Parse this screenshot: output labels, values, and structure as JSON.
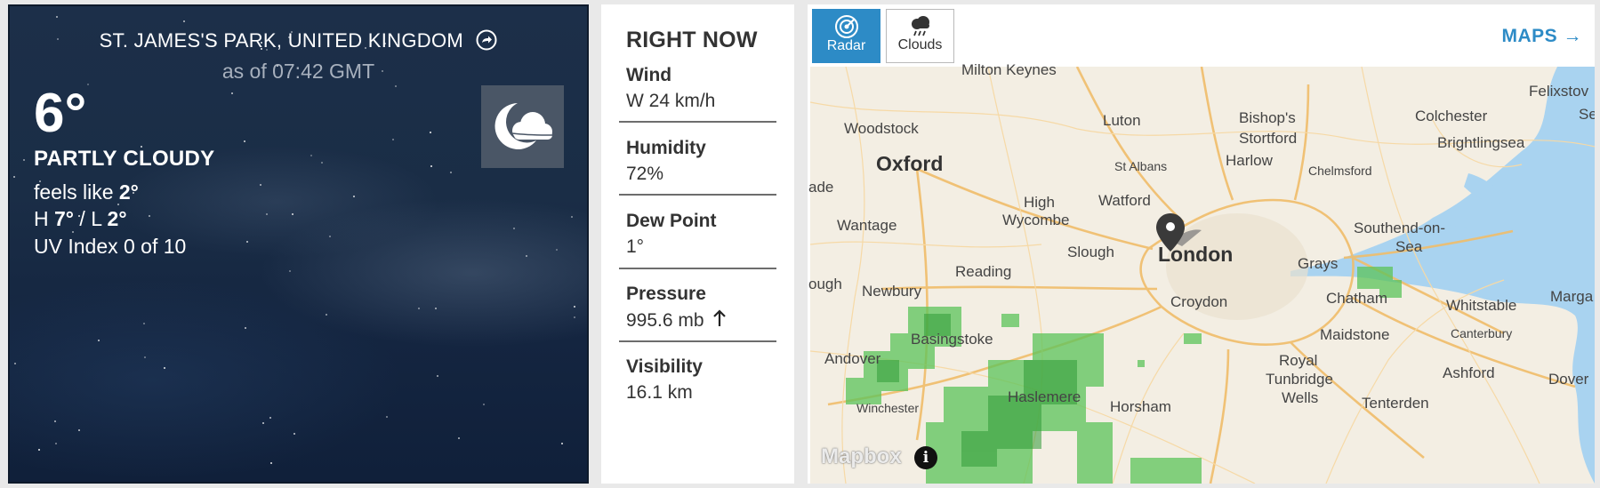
{
  "current": {
    "location": "ST. JAMES'S PARK, UNITED KINGDOM",
    "as_of": "as of 07:42 GMT",
    "temperature": "6°",
    "condition": "PARTLY CLOUDY",
    "feels_like_label": "feels like",
    "feels_like_value": "2°",
    "high_label": "H",
    "high_value": "7°",
    "low_label": "L",
    "low_value": "2°",
    "uv_index": "UV Index 0 of 10",
    "icon": "moon-cloud-icon"
  },
  "right_now": {
    "title": "RIGHT NOW",
    "items": [
      {
        "label": "Wind",
        "value": "W 24 km/h"
      },
      {
        "label": "Humidity",
        "value": "72%"
      },
      {
        "label": "Dew Point",
        "value": "1°"
      },
      {
        "label": "Pressure",
        "value": "995.6 mb",
        "trend_icon": "arrow-up-icon"
      },
      {
        "label": "Visibility",
        "value": "16.1 km"
      }
    ]
  },
  "map": {
    "buttons": [
      {
        "label": "Radar",
        "icon": "radar-icon",
        "active": true
      },
      {
        "label": "Clouds",
        "icon": "cloud-rain-icon",
        "active": false
      }
    ],
    "maps_link": "MAPS →",
    "attribution": "Mapbox",
    "info": "i",
    "places": {
      "milton_keynes": "Milton Keynes",
      "felixstowe": "Felixstov",
      "se": "Se",
      "luton": "Luton",
      "bishops_stortford_1": "Bishop's",
      "bishops_stortford_2": "Stortford",
      "colchester": "Colchester",
      "woodstock": "Woodstock",
      "brightlingsea": "Brightlingsea",
      "oxford": "Oxford",
      "harlow": "Harlow",
      "st_albans": "St Albans",
      "chelmsford": "Chelmsford",
      "ade": "ade",
      "high_wycombe_1": "High",
      "high_wycombe_2": "Wycombe",
      "watford": "Watford",
      "wantage": "Wantage",
      "southend_1": "Southend-on-",
      "southend_2": "Sea",
      "slough": "Slough",
      "london": "London",
      "reading": "Reading",
      "grays": "Grays",
      "ough": "ough",
      "newbury": "Newbury",
      "croydon": "Croydon",
      "chatham": "Chatham",
      "whitstable": "Whitstable",
      "marga": "Marga",
      "basingstoke": "Basingstoke",
      "maidstone": "Maidstone",
      "canterbury": "Canterbury",
      "andover": "Andover",
      "royal_tunbridge_1": "Royal",
      "royal_tunbridge_2": "Tunbridge",
      "royal_tunbridge_3": "Wells",
      "ashford": "Ashford",
      "dover": "Dover",
      "winchester": "Winchester",
      "haslemere": "Haslemere",
      "horsham": "Horsham",
      "tenterden": "Tenterden"
    }
  },
  "colors": {
    "accent": "#2d8bc6",
    "panel_dark": "#1a2d46",
    "radar_green": "#5cc45a",
    "sea": "#a9d3f0",
    "map_land": "#f3eee3",
    "roads": "#f2c47a"
  }
}
